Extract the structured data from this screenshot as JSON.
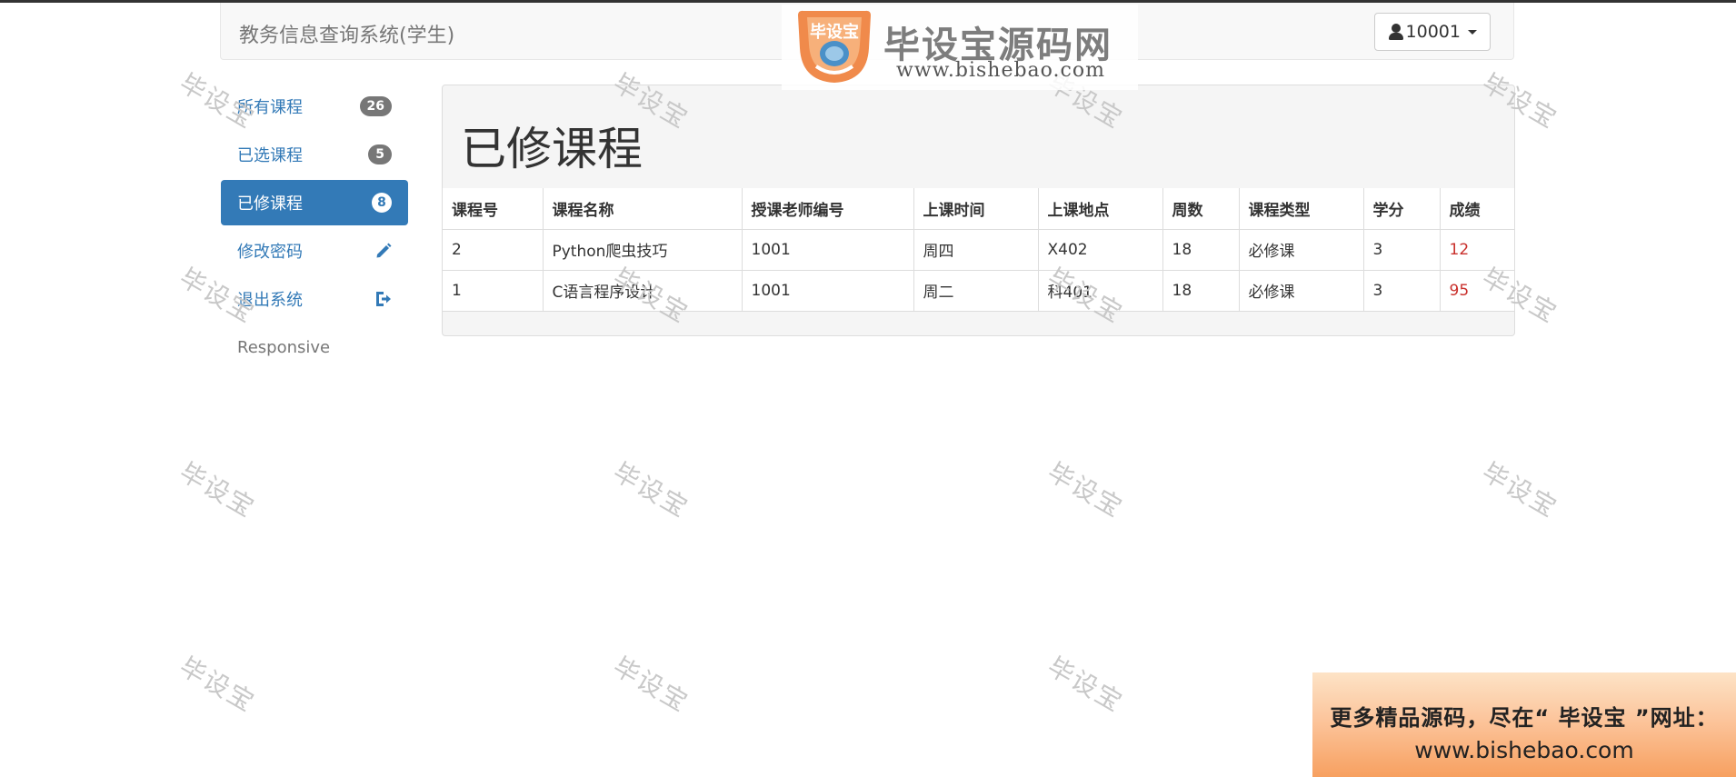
{
  "navbar": {
    "brand": "教务信息查询系统(学生)",
    "user": "10001"
  },
  "sidebar": {
    "items": [
      {
        "label": "所有课程",
        "badge": "26"
      },
      {
        "label": "已选课程",
        "badge": "5"
      },
      {
        "label": "已修课程",
        "badge": "8"
      },
      {
        "label": "修改密码",
        "icon": "pencil-icon"
      },
      {
        "label": "退出系统",
        "icon": "sign-out-icon"
      }
    ],
    "footer": "Responsive"
  },
  "panel": {
    "title": "已修课程",
    "columns": [
      "课程号",
      "课程名称",
      "授课老师编号",
      "上课时间",
      "上课地点",
      "周数",
      "课程类型",
      "学分",
      "成绩"
    ],
    "rows": [
      [
        "2",
        "Python爬虫技巧",
        "1001",
        "周四",
        "X402",
        "18",
        "必修课",
        "3",
        "12"
      ],
      [
        "1",
        "C语言程序设计",
        "1001",
        "周二",
        "科401",
        "18",
        "必修课",
        "3",
        "95"
      ]
    ]
  },
  "watermark": {
    "text": "毕设宝"
  },
  "logo": {
    "badge_text": "毕设宝",
    "title": "毕设宝源码网",
    "url": "www.bishebao.com"
  },
  "ad": {
    "line1": "更多精品源码，尽在“ 毕设宝 ”网址：",
    "line2": "www.bishebao.com"
  },
  "colors": {
    "primary": "#337ab7",
    "grade": "#c9302c",
    "badge": "#777777"
  }
}
